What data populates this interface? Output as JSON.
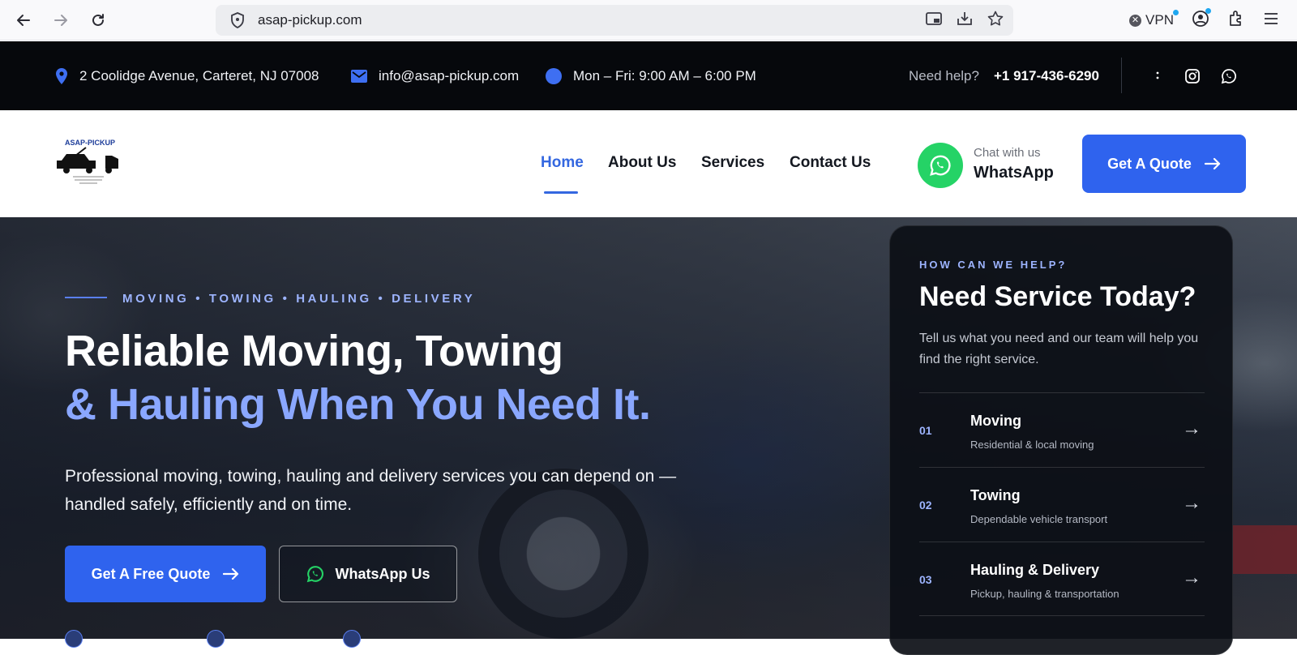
{
  "browser": {
    "url": "asap-pickup.com",
    "vpn_label": "VPN"
  },
  "topbar": {
    "address": "2 Coolidge Avenue, Carteret, NJ 07008",
    "email": "info@asap-pickup.com",
    "hours": "Mon – Fri: 9:00 AM – 6:00 PM",
    "help_label": "Need help?",
    "phone": "+1 917-436-6290"
  },
  "nav": {
    "logo_text": "ASAP-PICKUP",
    "items": [
      {
        "label": "Home",
        "active": true
      },
      {
        "label": "About Us"
      },
      {
        "label": "Services"
      },
      {
        "label": "Contact Us"
      }
    ],
    "chat_small": "Chat with us",
    "chat_big": "WhatsApp",
    "quote_label": "Get A Quote"
  },
  "hero": {
    "eyebrow": "MOVING • TOWING • HAULING • DELIVERY",
    "title_line1": "Reliable Moving, Towing",
    "title_line2": "& Hauling When You Need It.",
    "lede": "Professional moving, towing, hauling and delivery services you can depend on — handled safely, efficiently and on time.",
    "primary_btn": "Get A Free Quote",
    "secondary_btn": "WhatsApp Us"
  },
  "card": {
    "eyebrow": "HOW CAN WE HELP?",
    "title": "Need Service Today?",
    "description": "Tell us what you need and our team will help you find the right service.",
    "services": [
      {
        "num": "01",
        "name": "Moving",
        "sub": "Residential & local moving"
      },
      {
        "num": "02",
        "name": "Towing",
        "sub": "Dependable vehicle transport"
      },
      {
        "num": "03",
        "name": "Hauling & Delivery",
        "sub": "Pickup, hauling & transportation"
      }
    ]
  },
  "colors": {
    "brand_blue": "#2f63ee",
    "accent_light_blue": "#8aa7ff",
    "whatsapp_green": "#25d366",
    "topbar_bg": "#06080c"
  }
}
